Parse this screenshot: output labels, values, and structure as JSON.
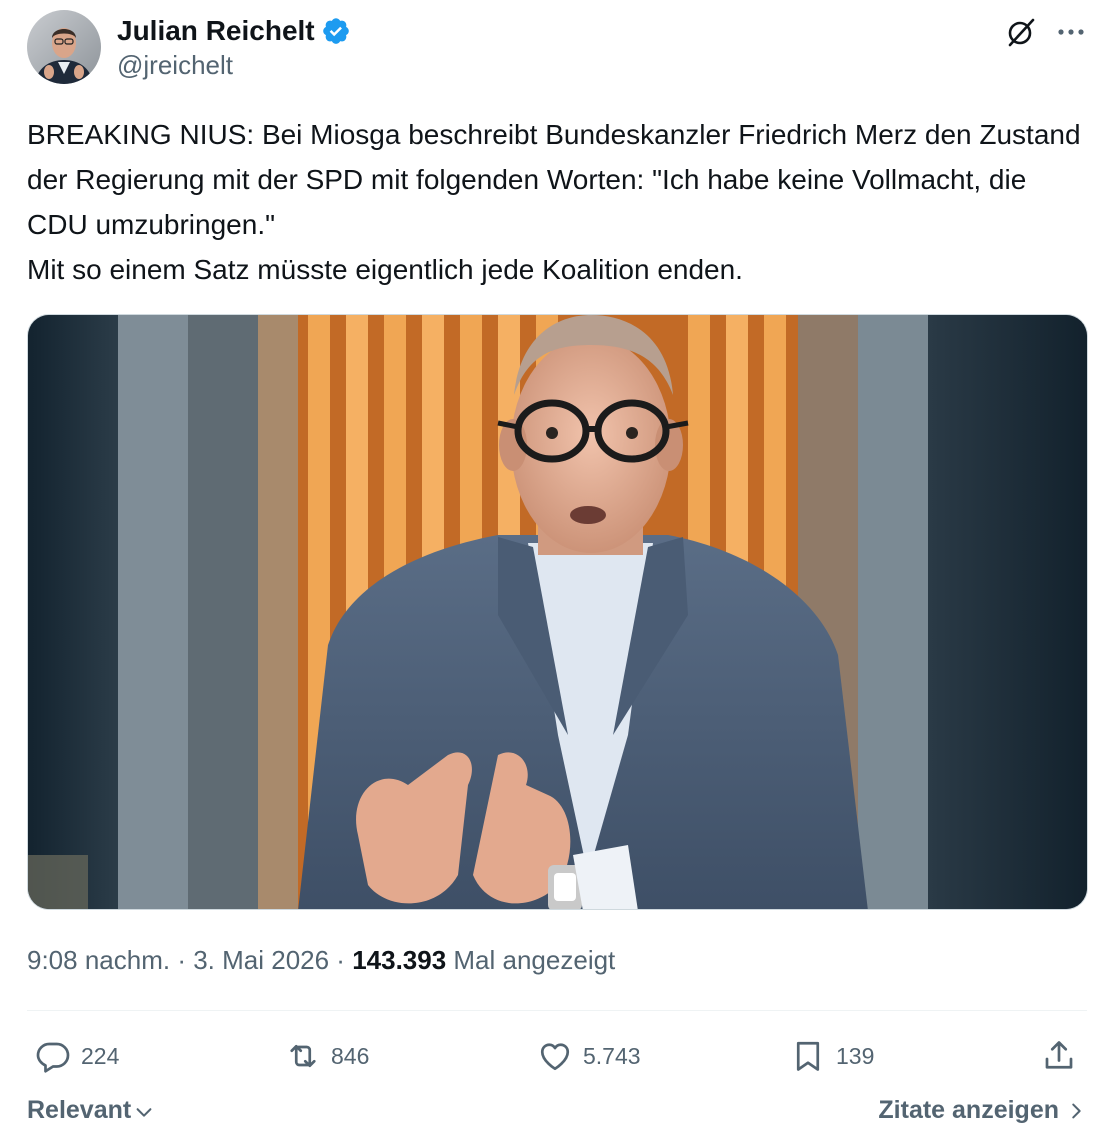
{
  "author": {
    "display_name": "Julian Reichelt",
    "handle": "@jreichelt",
    "verified_icon": "verified-badge-icon",
    "verified_color": "#1d9bf0"
  },
  "tweet": {
    "text": "BREAKING NIUS: Bei Miosga beschreibt Bundeskanzler Friedrich Merz den Zustand der Regierung mit der SPD mit folgenden Worten: \"Ich habe keine Vollmacht, die CDU umzubringen.\"\nMit so einem Satz müsste eigentlich jede Koalition enden."
  },
  "meta": {
    "time": "9:08 nachm.",
    "separator": " · ",
    "date": "3. Mai 2026",
    "views_count": "143.393",
    "views_label": " Mal angezeigt"
  },
  "actions": {
    "replies": "224",
    "reposts": "846",
    "likes": "5.743",
    "bookmarks": "139"
  },
  "footer": {
    "sort_label": "Relevant",
    "quotes_label": "Zitate anzeigen"
  },
  "colors": {
    "text_primary": "#0f1419",
    "text_secondary": "#536471",
    "accent": "#1d9bf0"
  }
}
